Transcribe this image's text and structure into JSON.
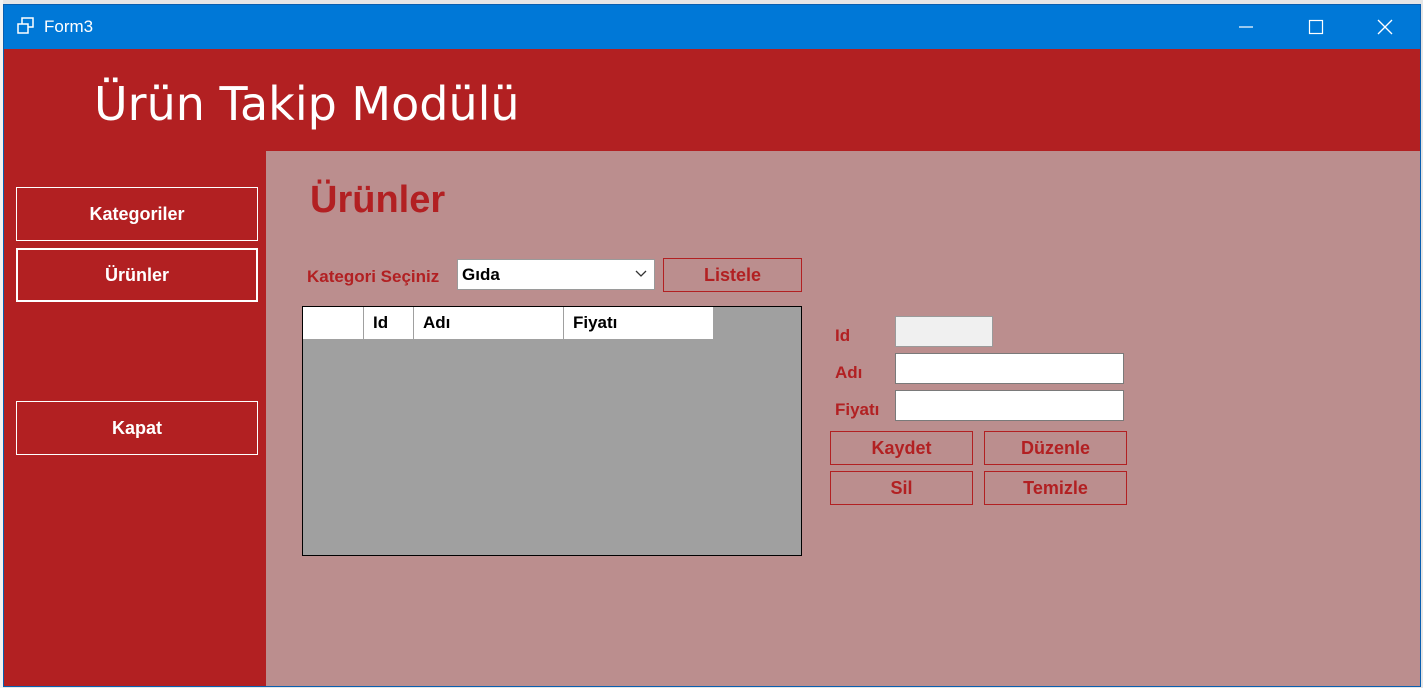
{
  "window": {
    "title": "Form3",
    "icon": "app-window-icon"
  },
  "header": {
    "title": "Ürün Takip Modülü"
  },
  "sidebar": {
    "items": [
      {
        "label": "Kategoriler"
      },
      {
        "label": "Ürünler",
        "active": true
      },
      {
        "label": "Kapat"
      }
    ]
  },
  "main": {
    "title": "Ürünler",
    "category_label": "Kategori Seçiniz",
    "category_selected": "Gıda",
    "list_button": "Listele",
    "grid": {
      "columns": [
        "",
        "Id",
        "Adı",
        "Fiyatı"
      ]
    },
    "form": {
      "id_label": "Id",
      "name_label": "Adı",
      "price_label": "Fiyatı",
      "id_value": "",
      "name_value": "",
      "price_value": ""
    },
    "buttons": {
      "save": "Kaydet",
      "edit": "Düzenle",
      "delete": "Sil",
      "clear": "Temizle"
    }
  },
  "colors": {
    "titlebar": "#0078d7",
    "primary_red": "#b22022",
    "content_bg": "#bb8e8e",
    "grid_bg": "#a0a0a0"
  }
}
